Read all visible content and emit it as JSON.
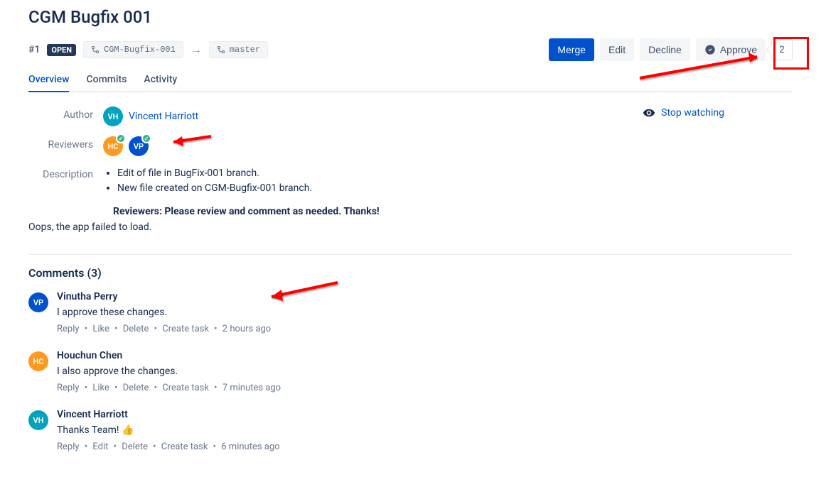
{
  "pr": {
    "title": "CGM Bugfix 001",
    "number": "#1",
    "state": "OPEN",
    "source_branch": "CGM-Bugfix-001",
    "target_branch": "master",
    "approve_count": "2"
  },
  "actions": {
    "merge": "Merge",
    "edit": "Edit",
    "decline": "Decline",
    "approve": "Approve"
  },
  "tabs": {
    "overview": "Overview",
    "commits": "Commits",
    "activity": "Activity"
  },
  "meta": {
    "labels": {
      "author": "Author",
      "reviewers": "Reviewers",
      "description": "Description"
    },
    "author": {
      "initials": "VH",
      "name": "Vincent Harriott"
    },
    "reviewers": [
      {
        "initials": "HC",
        "color": "orange",
        "approved": true
      },
      {
        "initials": "VP",
        "color": "blue",
        "approved": true
      }
    ],
    "description": {
      "items": [
        "Edit of file in BugFix-001 branch.",
        "New file created on CGM-Bugfix-001 branch."
      ],
      "note": "Reviewers: Please review and comment as needed. Thanks!"
    },
    "error": "Oops, the app failed to load."
  },
  "watch": {
    "label": "Stop watching"
  },
  "comments": {
    "heading": "Comments (3)",
    "actions": {
      "reply": "Reply",
      "like": "Like",
      "edit": "Edit",
      "delete": "Delete",
      "create_task": "Create task"
    },
    "items": [
      {
        "initials": "VP",
        "color": "blue",
        "author": "Vinutha Perry",
        "text": "I approve these changes.",
        "actions": [
          "reply",
          "like",
          "delete",
          "create_task"
        ],
        "time": "2 hours ago"
      },
      {
        "initials": "HC",
        "color": "orange",
        "author": "Houchun Chen",
        "text": "I also approve the changes.",
        "actions": [
          "reply",
          "like",
          "delete",
          "create_task"
        ],
        "time": "7 minutes ago"
      },
      {
        "initials": "VH",
        "color": "teal",
        "author": "Vincent Harriott",
        "text": "Thanks Team! 👍",
        "actions": [
          "reply",
          "edit",
          "delete",
          "create_task"
        ],
        "time": "6 minutes ago"
      }
    ]
  }
}
